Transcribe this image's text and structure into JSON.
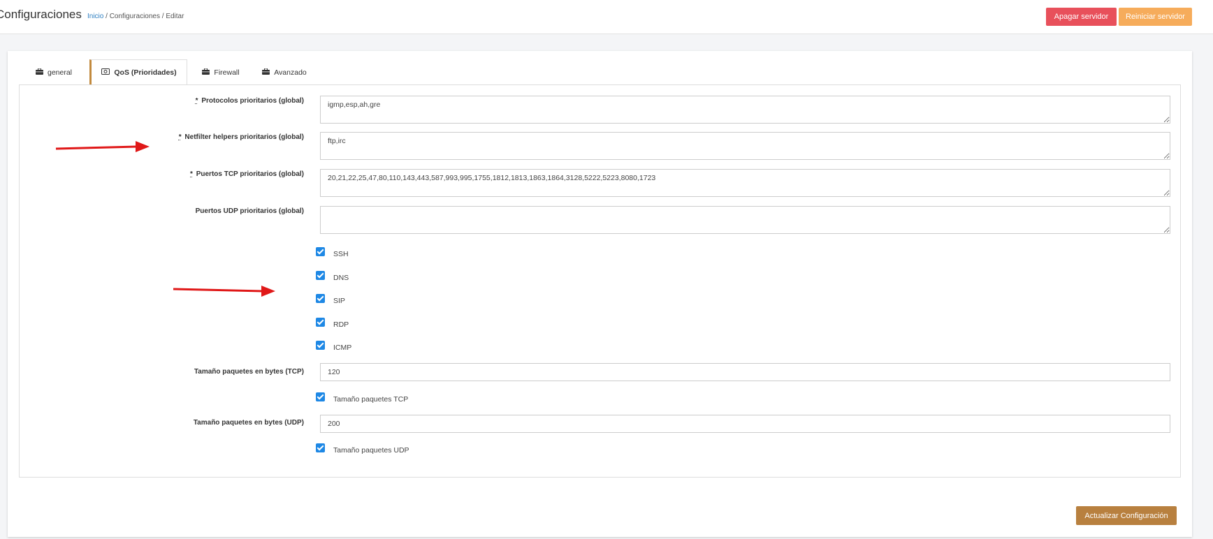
{
  "header": {
    "title": "Configuraciones",
    "breadcrumb": {
      "home": "Inicio",
      "sep1": " / ",
      "section": "Configuraciones",
      "sep2": " / ",
      "current": "Editar"
    },
    "buttons": {
      "shutdown": "Apagar servidor",
      "restart": "Reiniciar servidor"
    }
  },
  "tabs": [
    {
      "label": "general",
      "icon": "briefcase-icon"
    },
    {
      "label": "QoS (Prioridades)",
      "icon": "money-icon"
    },
    {
      "label": "Firewall",
      "icon": "briefcase-icon"
    },
    {
      "label": "Avanzado",
      "icon": "briefcase-icon"
    }
  ],
  "form": {
    "protocols": {
      "label": "Protocolos prioritarios (global)",
      "required_mark": "*",
      "value": "igmp,esp,ah,gre"
    },
    "netfilter": {
      "label": "Netfilter helpers prioritarios (global)",
      "required_mark": "*",
      "value": "ftp,irc"
    },
    "tcp_ports": {
      "label": "Puertos TCP prioritarios (global)",
      "required_mark": "*",
      "value": "20,21,22,25,47,80,110,143,443,587,993,995,1755,1812,1813,1863,1864,3128,5222,5223,8080,1723"
    },
    "udp_ports": {
      "label": "Puertos UDP prioritarios (global)",
      "value": ""
    },
    "services": [
      {
        "label": "SSH",
        "checked": true
      },
      {
        "label": "DNS",
        "checked": true
      },
      {
        "label": "SIP",
        "checked": true
      },
      {
        "label": "RDP",
        "checked": true
      },
      {
        "label": "ICMP",
        "checked": true
      }
    ],
    "tcp_size": {
      "label": "Tamaño paquetes en bytes (TCP)",
      "value": "120",
      "check_label": "Tamaño paquetes TCP",
      "checked": true
    },
    "udp_size": {
      "label": "Tamaño paquetes en bytes (UDP)",
      "value": "200",
      "check_label": "Tamaño paquetes UDP",
      "checked": true
    }
  },
  "footer": {
    "update_button": "Actualizar Configuración"
  },
  "colors": {
    "accent": "#b8803f",
    "danger": "#e8505b",
    "warning": "#f6ac5b",
    "check": "#1e88e5",
    "link": "#2f80c2",
    "annotation": "#e01818"
  }
}
